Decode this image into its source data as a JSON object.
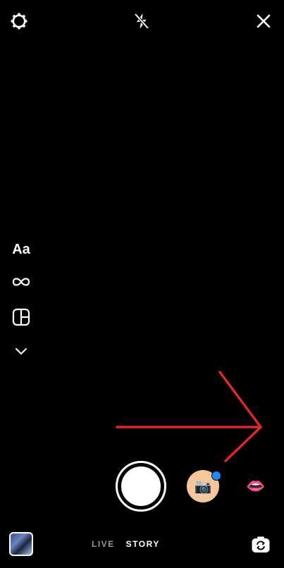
{
  "top_bar": {
    "settings_icon": "gear-icon",
    "flash_icon": "flash-off-icon",
    "close_icon": "close-icon"
  },
  "tools": {
    "text_label": "Aa",
    "boomerang_icon": "infinity-icon",
    "layout_icon": "layout-icon",
    "more_icon": "chevron-down-icon"
  },
  "capture": {
    "shutter_icon": "shutter-button",
    "effects": [
      "camera-effect-icon",
      "face-effect-icon"
    ],
    "photo_effect_glyph": "📷",
    "face_effect_glyph": "👄",
    "new_effect_dot_color": "#1a8cff"
  },
  "bottom_bar": {
    "modes": [
      "LIVE",
      "STORY"
    ],
    "selected_mode": "STORY",
    "flip_icon": "camera-flip-icon"
  },
  "colors": {
    "background": "#000000",
    "annotation_arrow": "#e0262b"
  }
}
